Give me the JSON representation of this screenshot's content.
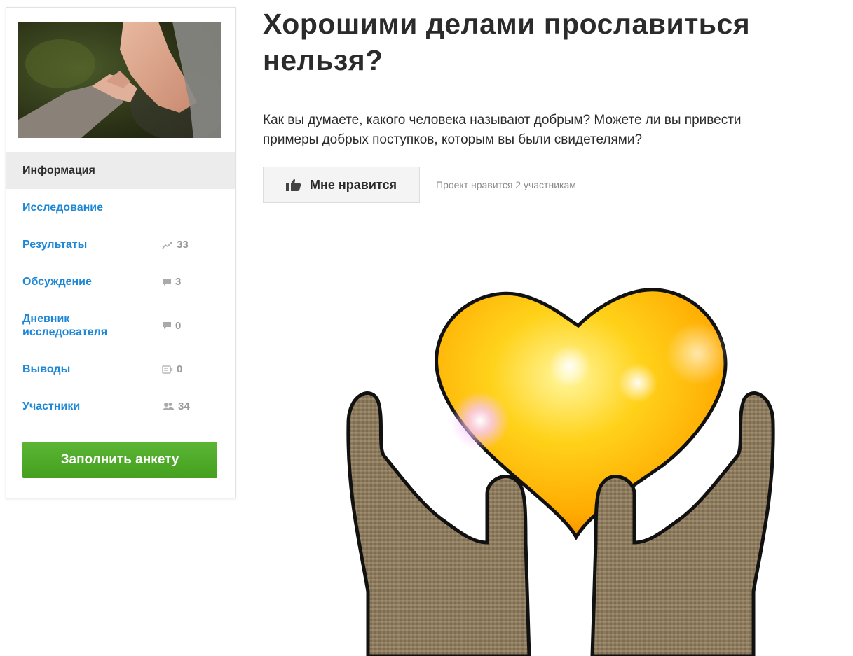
{
  "sidebar": {
    "menu": [
      {
        "label": "Информация",
        "count": "",
        "icon": ""
      },
      {
        "label": "Исследование",
        "count": "",
        "icon": ""
      },
      {
        "label": "Результаты",
        "count": "33",
        "icon": "chart-line-icon"
      },
      {
        "label": "Обсуждение",
        "count": "3",
        "icon": "comment-icon"
      },
      {
        "label": "Дневник исследователя",
        "count": "0",
        "icon": "comment-icon"
      },
      {
        "label": "Выводы",
        "count": "0",
        "icon": "conclusion-icon"
      },
      {
        "label": "Участники",
        "count": "34",
        "icon": "users-icon"
      }
    ],
    "active_item": "Информация",
    "fill_button_label": "Заполнить анкету"
  },
  "main": {
    "title": "Хорошими делами прославиться нельзя?",
    "description_line1": "Как вы думаете, какого человека называют добрым? Можете ли вы привести",
    "description_line2": "примеры добрых поступков, которым вы были свидетелями?",
    "like_button_label": "Мне нравится",
    "like_count_text": "Проект нравится 2 участникам"
  },
  "colors": {
    "link": "#1e88d6",
    "active_bg": "#ececec",
    "button_green": "#4fa82a",
    "count_gray": "#9a9a9a"
  }
}
